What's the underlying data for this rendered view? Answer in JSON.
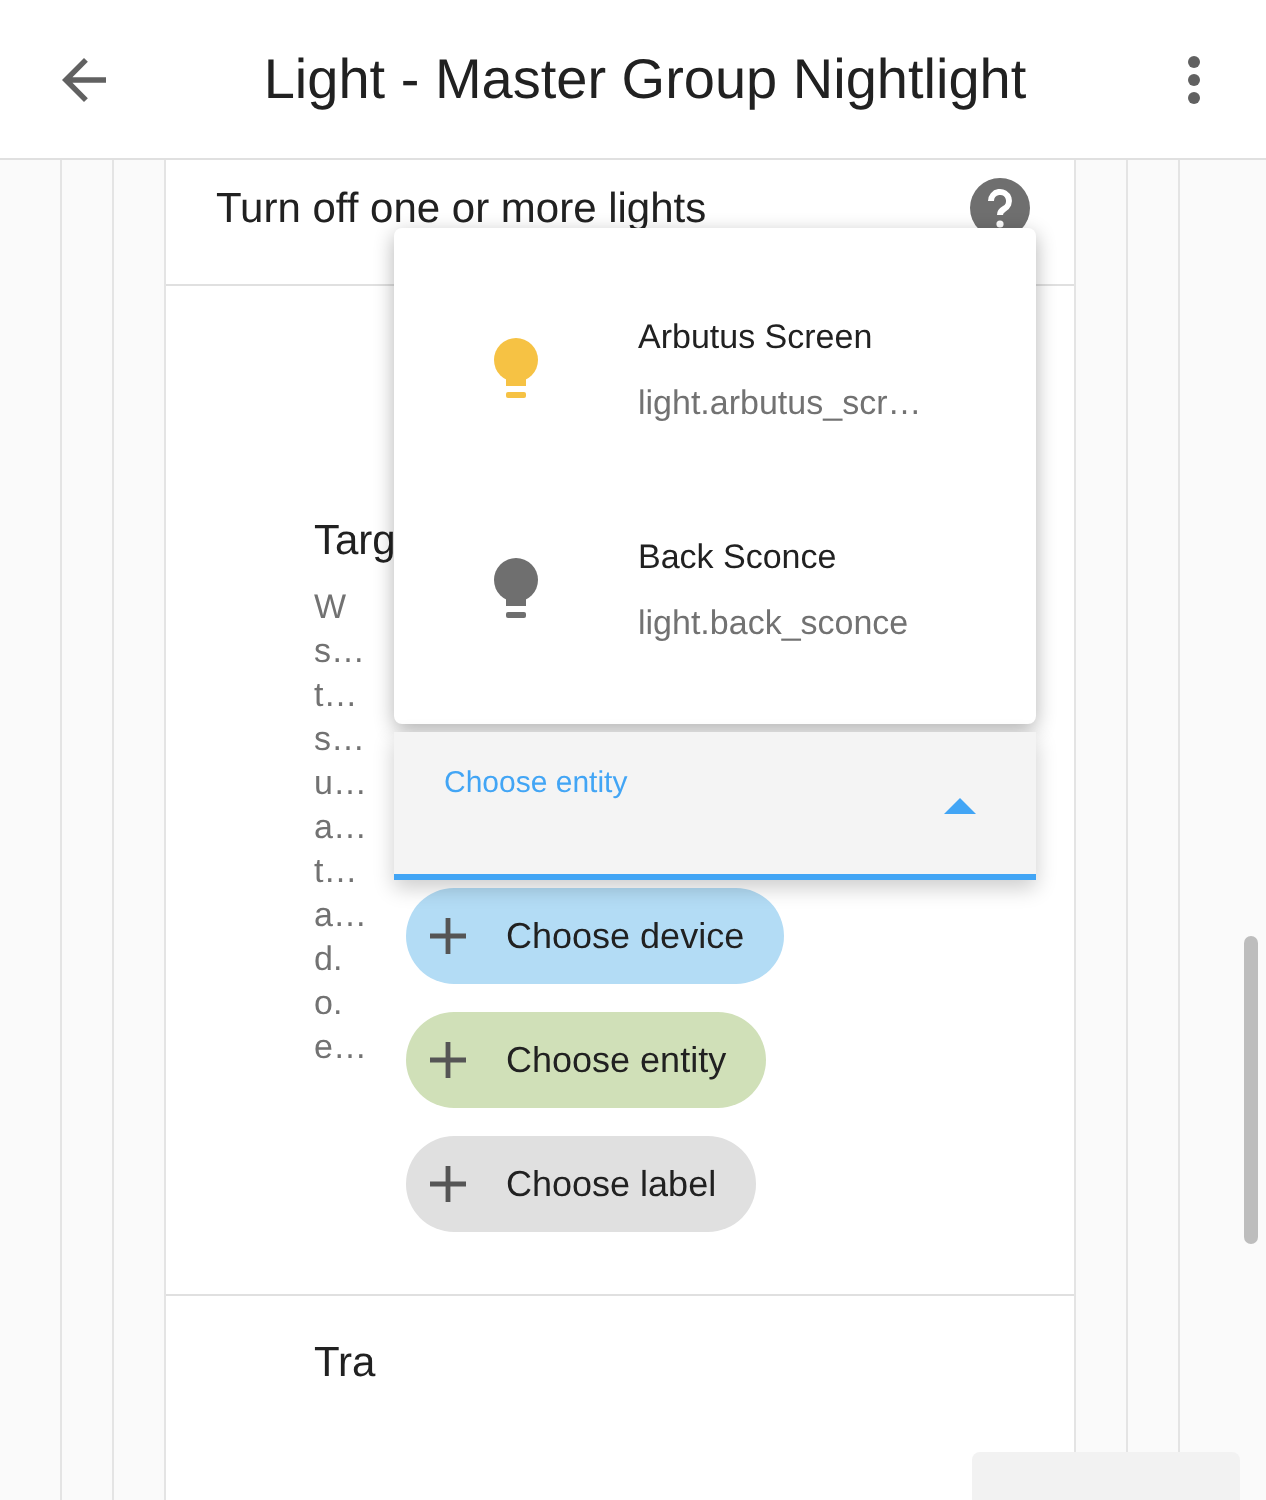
{
  "header": {
    "title": "Light - Master Group Nightlight"
  },
  "card": {
    "title": "Turn off one or more lights",
    "target": {
      "heading": "Targ",
      "description_lines": [
        "W",
        "s…",
        "t…",
        "s…",
        "u…",
        "a…",
        "t…",
        "a…",
        "d.",
        "o.",
        "e…"
      ],
      "chips": [
        {
          "label": "Choose device",
          "color": "#b3dcf5"
        },
        {
          "label": "Choose entity",
          "color": "#d0e0b8"
        },
        {
          "label": "Choose label",
          "color": "#e0e0e0"
        }
      ]
    },
    "next_heading": "Tra"
  },
  "dropdown": {
    "items": [
      {
        "name": "Arbutus Screen",
        "entity_id": "light.arbutus_scr…",
        "on": true
      },
      {
        "name": "Back Sconce",
        "entity_id": "light.back_sconce",
        "on": false
      }
    ]
  },
  "entity_field": {
    "label": "Choose entity",
    "expanded": true
  }
}
